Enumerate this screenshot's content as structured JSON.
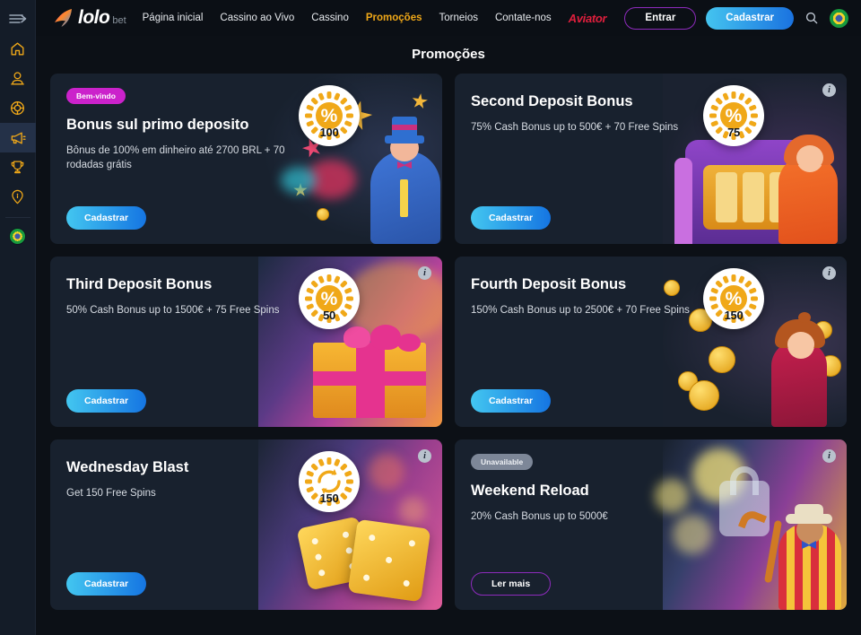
{
  "sidebar": {
    "items": [
      {
        "name": "collapse-toggle",
        "icon": "menu-arrow-icon",
        "active": false
      },
      {
        "name": "home",
        "icon": "home-icon",
        "active": false
      },
      {
        "name": "live-casino",
        "icon": "live-dealer-icon",
        "active": false
      },
      {
        "name": "casino",
        "icon": "casino-chip-icon",
        "active": false
      },
      {
        "name": "promotions",
        "icon": "megaphone-icon",
        "active": true
      },
      {
        "name": "tournaments",
        "icon": "trophy-icon",
        "active": false
      },
      {
        "name": "info",
        "icon": "info-pin-icon",
        "active": false
      }
    ],
    "language_flag": "brazil-flag-icon"
  },
  "header": {
    "logo": {
      "word": "lolo",
      "suffix": "bet",
      "icon": "lolobet-bird-icon"
    },
    "nav": [
      {
        "label": "Página inicial",
        "active": false,
        "style": "normal"
      },
      {
        "label": "Cassino ao Vivo",
        "active": false,
        "style": "normal"
      },
      {
        "label": "Cassino",
        "active": false,
        "style": "normal"
      },
      {
        "label": "Promoções",
        "active": true,
        "style": "normal"
      },
      {
        "label": "Torneios",
        "active": false,
        "style": "normal"
      },
      {
        "label": "Contate-nos",
        "active": false,
        "style": "normal"
      },
      {
        "label": "Aviator",
        "active": false,
        "style": "aviator"
      }
    ],
    "login_label": "Entrar",
    "signup_label": "Cadastrar",
    "search_icon": "search-icon",
    "flag_icon": "brazil-flag-icon"
  },
  "page": {
    "title": "Promoções"
  },
  "colors": {
    "accent_yellow": "#f0a818",
    "accent_magenta": "#cb22cb",
    "accent_purple": "#8e2bbd",
    "accent_red": "#e01f3d",
    "button_gradient_start": "#43c6f0",
    "button_gradient_end": "#1575e2",
    "card_bg": "#18212e",
    "page_bg": "#0c1016"
  },
  "promotions": [
    {
      "id": "first-deposit",
      "badge": "Bem-vindo",
      "badge_type": "welcome",
      "title": "Bonus sul primo deposito",
      "description": "Bônus de 100% em dinheiro até 2700 BRL + 70 rodadas grátis",
      "cta": "Cadastrar",
      "cta_type": "filled",
      "chip_value": "100",
      "chip_symbol": "%",
      "has_info": false,
      "art": "magician"
    },
    {
      "id": "second-deposit",
      "badge": null,
      "badge_type": null,
      "title": "Second Deposit Bonus",
      "description": "75% Cash Bonus up to 500€ + 70 Free Spins",
      "cta": "Cadastrar",
      "cta_type": "filled",
      "chip_value": "75",
      "chip_symbol": "%",
      "has_info": true,
      "art": "slot-woman"
    },
    {
      "id": "third-deposit",
      "badge": null,
      "badge_type": null,
      "title": "Third Deposit Bonus",
      "description": "50% Cash Bonus up to 1500€ + 75 Free Spins",
      "cta": "Cadastrar",
      "cta_type": "filled",
      "chip_value": "50",
      "chip_symbol": "%",
      "has_info": true,
      "art": "gift-box"
    },
    {
      "id": "fourth-deposit",
      "badge": null,
      "badge_type": null,
      "title": "Fourth Deposit Bonus",
      "description": "150% Cash Bonus up to 2500€ + 70 Free Spins",
      "cta": "Cadastrar",
      "cta_type": "filled",
      "chip_value": "150",
      "chip_symbol": "%",
      "has_info": true,
      "art": "coins-woman"
    },
    {
      "id": "wednesday-blast",
      "badge": null,
      "badge_type": null,
      "title": "Wednesday Blast",
      "description": "Get 150 Free Spins",
      "cta": "Cadastrar",
      "cta_type": "filled",
      "chip_value": "150",
      "chip_symbol": "spin",
      "has_info": true,
      "art": "dice"
    },
    {
      "id": "weekend-reload",
      "badge": "Unavailable",
      "badge_type": "unavailable",
      "title": "Weekend Reload",
      "description": "20% Cash Bonus up to 5000€",
      "cta": "Ler mais",
      "cta_type": "outline",
      "chip_value": null,
      "chip_symbol": null,
      "has_info": true,
      "art": "ringmaster"
    }
  ],
  "info_icon_glyph": "i"
}
